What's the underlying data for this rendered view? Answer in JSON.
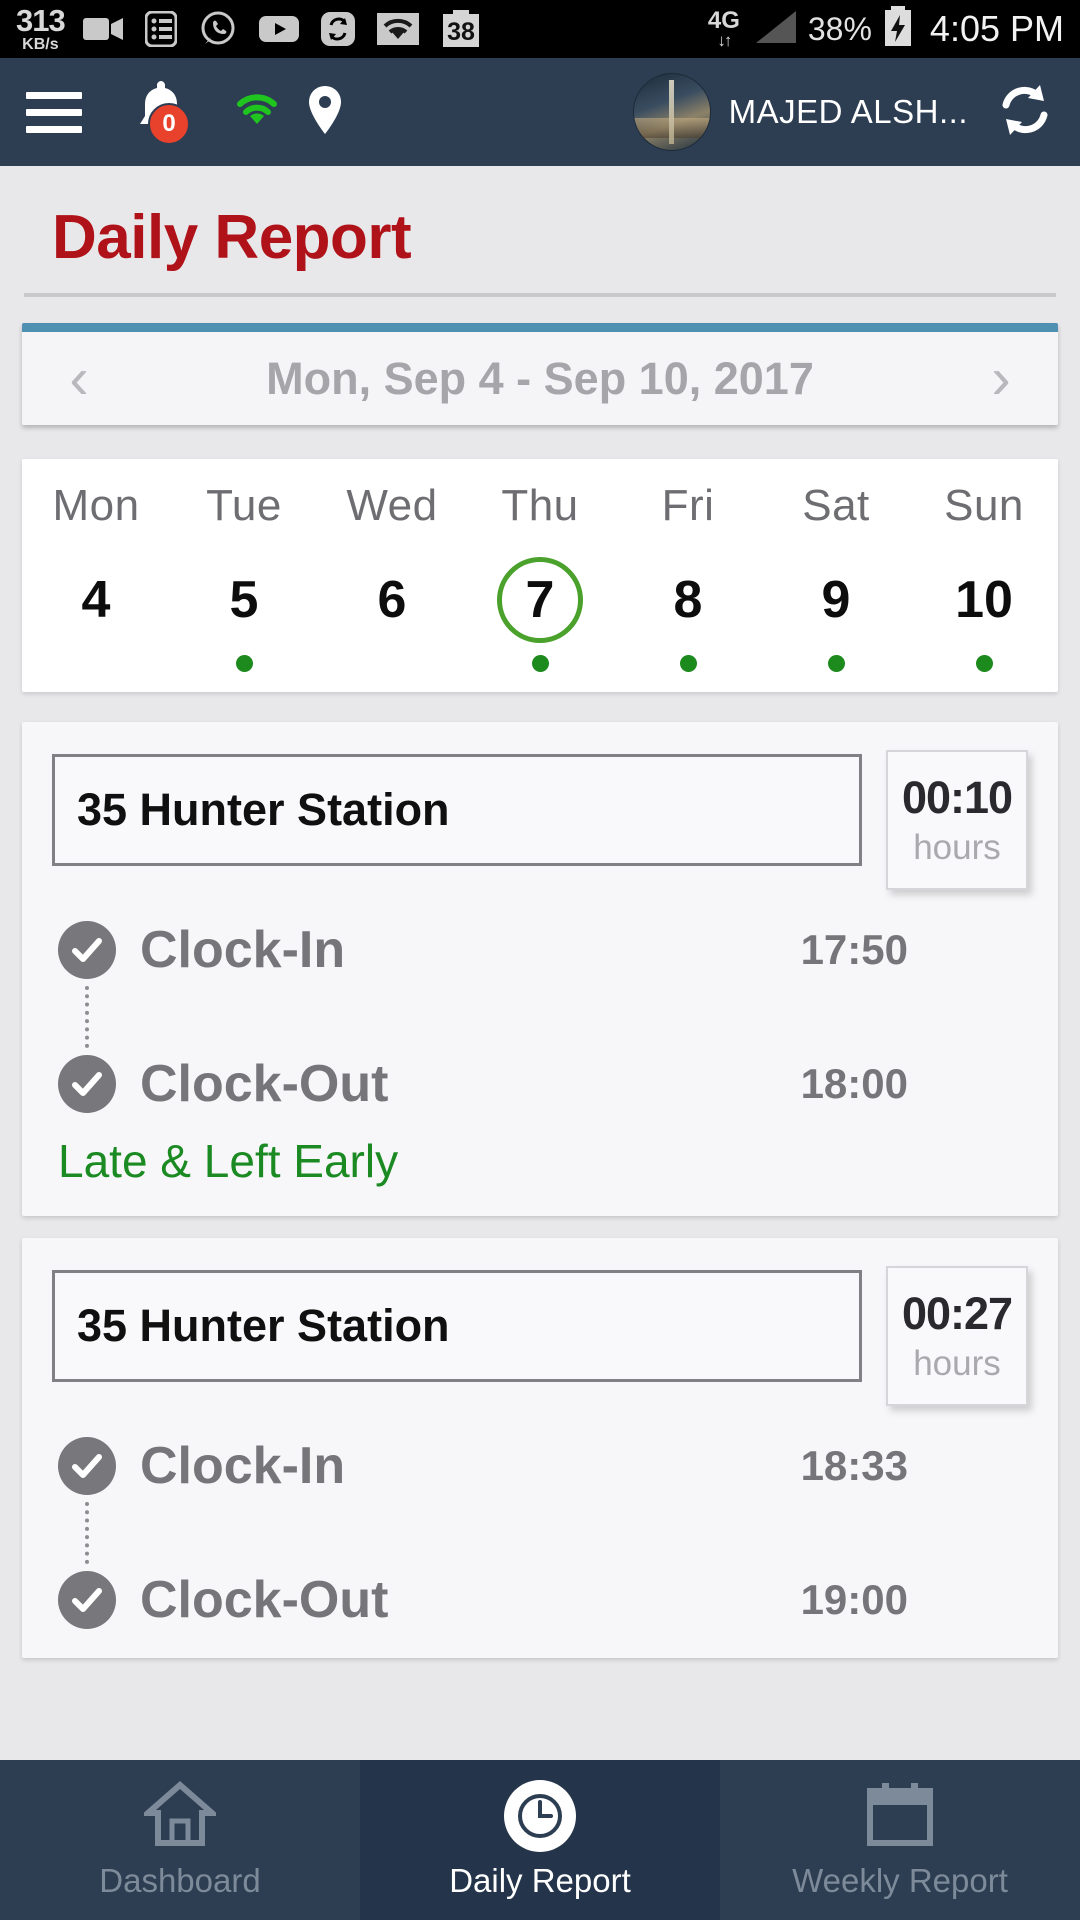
{
  "status_bar": {
    "net_speed_value": "313",
    "net_speed_unit": "KB/s",
    "icons": [
      "camcorder-icon",
      "list-icon",
      "whatsapp-icon",
      "youtube-icon",
      "sync-icon",
      "wifi-icon",
      "counter-38-icon"
    ],
    "counter_badge": "38",
    "network_type": "4G",
    "data_arrows": "↓↑",
    "battery_percent": "38%",
    "time": "4:05 PM"
  },
  "app_bar": {
    "menu_icon": "hamburger-icon",
    "notification_icon": "bell-icon",
    "notification_count": "0",
    "wifi_icon": "wifi-green-icon",
    "location_icon": "location-pin-icon",
    "user_name": "MAJED ALSH...",
    "refresh_icon": "refresh-icon"
  },
  "page": {
    "title": "Daily Report"
  },
  "week_nav": {
    "prev_label": "‹",
    "next_label": "›",
    "range_label": "Mon, Sep 4 - Sep 10, 2017",
    "accent_color": "#4e90b2"
  },
  "day_strip": {
    "selected_color": "#4aa12c",
    "dot_color": "#1d8a1d",
    "days": [
      {
        "dow": "Mon",
        "num": "4",
        "selected": false,
        "has_dot": false
      },
      {
        "dow": "Tue",
        "num": "5",
        "selected": false,
        "has_dot": true
      },
      {
        "dow": "Wed",
        "num": "6",
        "selected": false,
        "has_dot": false
      },
      {
        "dow": "Thu",
        "num": "7",
        "selected": true,
        "has_dot": true
      },
      {
        "dow": "Fri",
        "num": "8",
        "selected": false,
        "has_dot": true
      },
      {
        "dow": "Sat",
        "num": "9",
        "selected": false,
        "has_dot": true
      },
      {
        "dow": "Sun",
        "num": "10",
        "selected": false,
        "has_dot": true
      }
    ]
  },
  "reports": [
    {
      "station": "35 Hunter Station",
      "hours_value": "00:10",
      "hours_unit": "hours",
      "clock_in_label": "Clock-In",
      "clock_in_time": "17:50",
      "clock_out_label": "Clock-Out",
      "clock_out_time": "18:00",
      "status_note": "Late & Left Early",
      "status_color": "#1b8a22"
    },
    {
      "station": "35 Hunter Station",
      "hours_value": "00:27",
      "hours_unit": "hours",
      "clock_in_label": "Clock-In",
      "clock_in_time": "18:33",
      "clock_out_label": "Clock-Out",
      "clock_out_time": "19:00",
      "status_note": "",
      "status_color": "#1b8a22"
    }
  ],
  "bottom_nav": {
    "items": [
      {
        "label": "Dashboard",
        "icon": "home-icon",
        "active": false
      },
      {
        "label": "Daily Report",
        "icon": "clock-icon",
        "active": true
      },
      {
        "label": "Weekly Report",
        "icon": "calendar-icon",
        "active": false
      }
    ]
  }
}
